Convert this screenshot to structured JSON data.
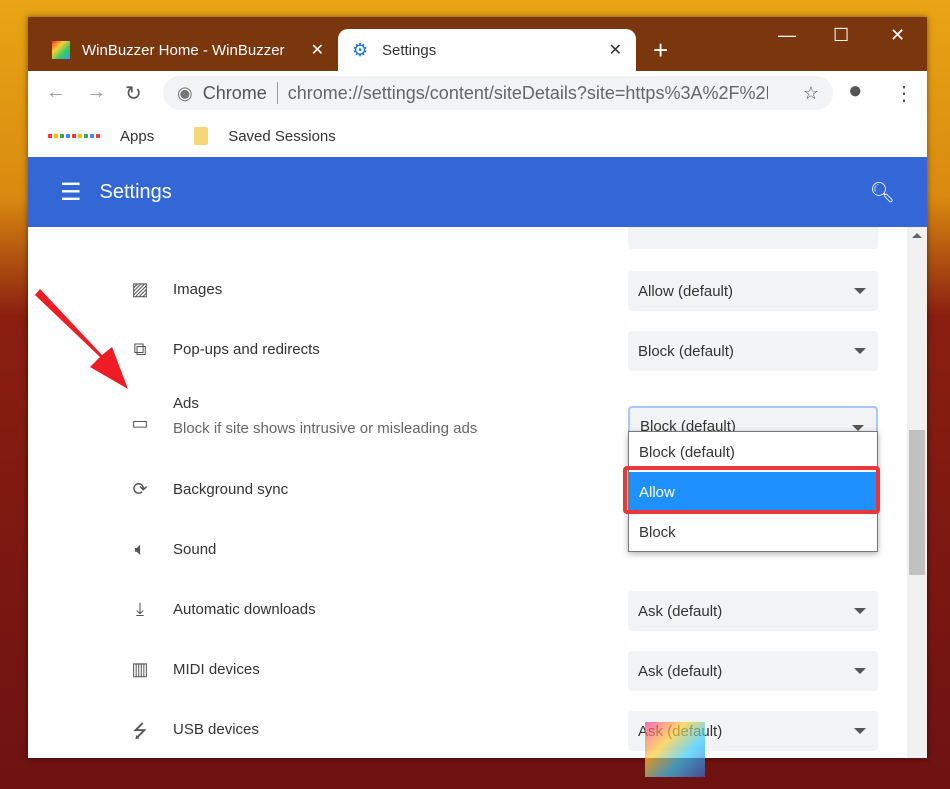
{
  "tabs": [
    {
      "label": "WinBuzzer Home - WinBuzzer",
      "active": false
    },
    {
      "label": "Settings",
      "active": true
    }
  ],
  "omnibox": {
    "chip": "Chrome",
    "url": "chrome://settings/content/siteDetails?site=https%3A%2F%2F..."
  },
  "bookmarks": [
    {
      "label": "Apps"
    },
    {
      "label": "Saved Sessions"
    }
  ],
  "header": {
    "title": "Settings"
  },
  "rows": [
    {
      "label": "Images",
      "value": "Allow (default)",
      "icon": "image-icon"
    },
    {
      "label": "Pop-ups and redirects",
      "value": "Block (default)",
      "icon": "open-in-new-icon"
    },
    {
      "label": "Ads",
      "sub": "Block if site shows intrusive or misleading ads",
      "value": "Block (default)",
      "icon": "web-window-icon"
    },
    {
      "label": "Background sync",
      "value": "",
      "icon": "sync-icon"
    },
    {
      "label": "Sound",
      "value": "",
      "icon": "volume-icon"
    },
    {
      "label": "Automatic downloads",
      "value": "Ask (default)",
      "icon": "download-icon"
    },
    {
      "label": "MIDI devices",
      "value": "Ask (default)",
      "icon": "piano-icon"
    },
    {
      "label": "USB devices",
      "value": "Ask (default)",
      "icon": "usb-icon"
    }
  ],
  "dropdown": {
    "options": [
      "Block (default)",
      "Allow",
      "Block"
    ],
    "highlighted": "Allow"
  },
  "watermark": "WinBuzzer",
  "colors": {
    "header": "#3367d6",
    "tabstrip": "#7a360c",
    "highlight": "#1e90ff",
    "annotation": "#e8383d"
  }
}
